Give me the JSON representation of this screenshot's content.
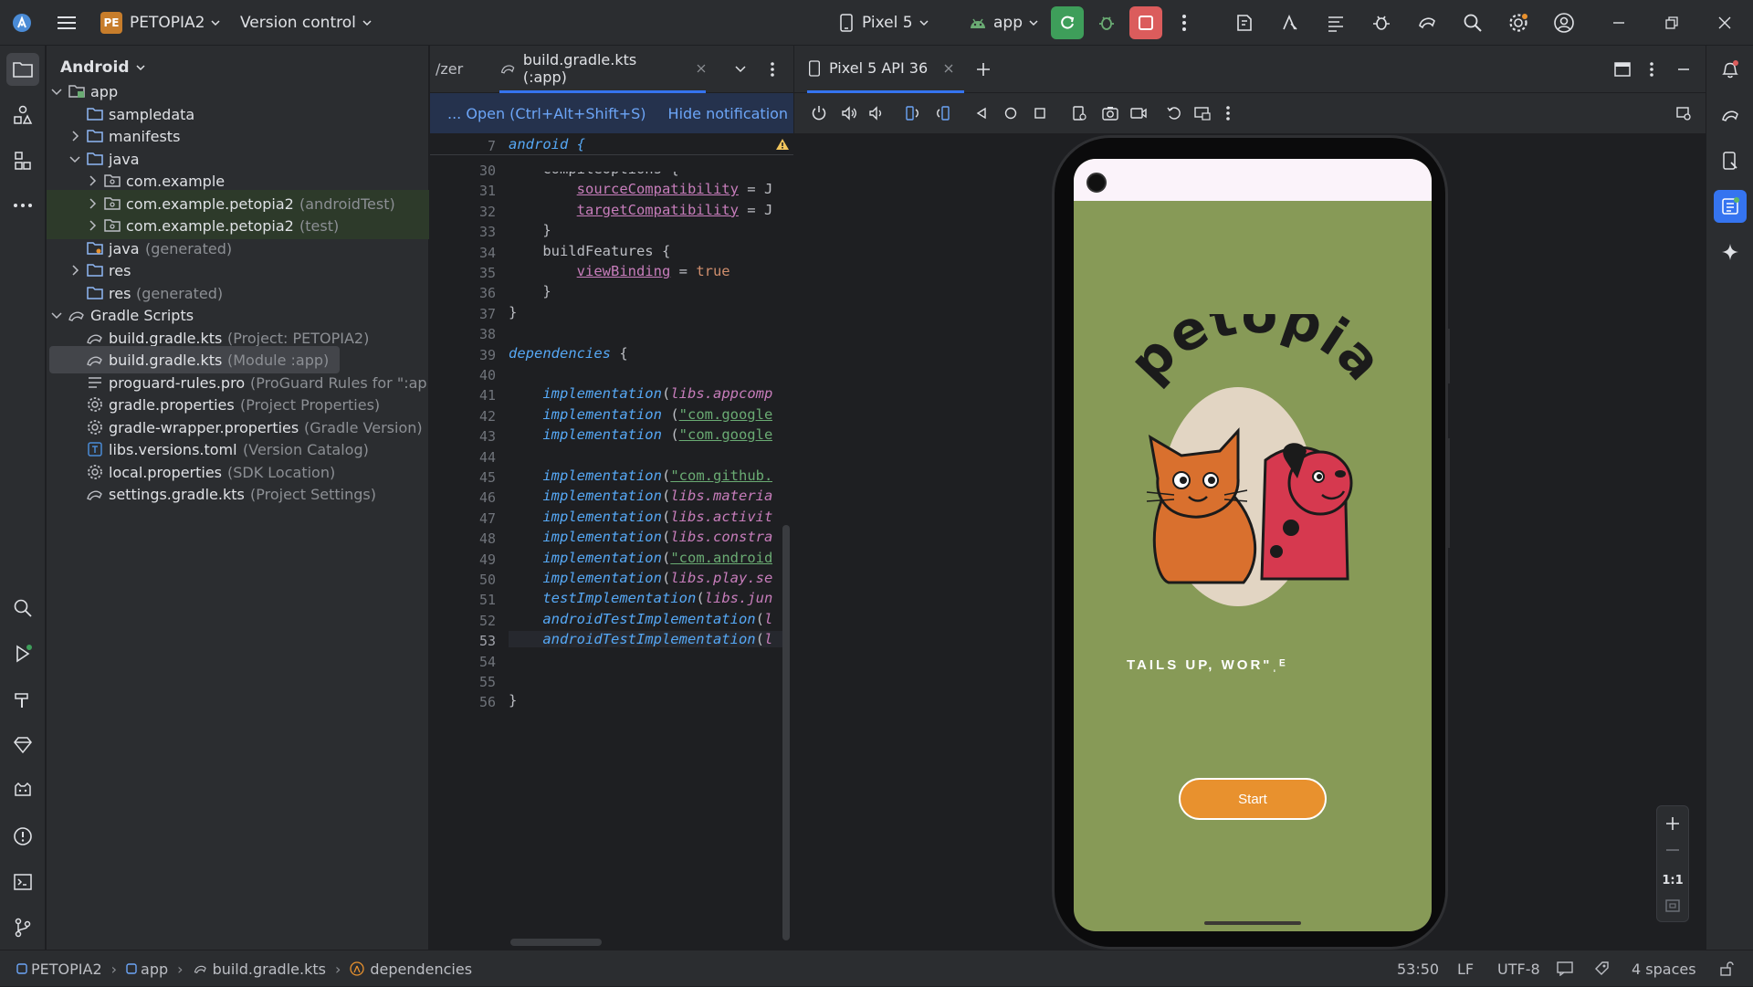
{
  "titlebar": {
    "project_badge": "PE",
    "project_name": "PETOPIA2",
    "vcs_label": "Version control",
    "device_label": "Pixel 5",
    "run_config": "app",
    "accent_green": "#3e9e5a",
    "accent_red": "#db5c5c"
  },
  "project_panel": {
    "title": "Android",
    "tree": [
      {
        "label": "app",
        "hint": "",
        "depth": 0,
        "expanded": true,
        "icon": "module-icon"
      },
      {
        "label": "sampledata",
        "hint": "",
        "depth": 1,
        "expanded": null,
        "icon": "folder-icon"
      },
      {
        "label": "manifests",
        "hint": "",
        "depth": 1,
        "expanded": false,
        "icon": "folder-icon"
      },
      {
        "label": "java",
        "hint": "",
        "depth": 1,
        "expanded": true,
        "icon": "folder-icon"
      },
      {
        "label": "com.example",
        "hint": "",
        "depth": 2,
        "expanded": false,
        "icon": "package-icon"
      },
      {
        "label": "com.example.petopia2",
        "hint": "(androidTest)",
        "depth": 2,
        "expanded": false,
        "icon": "package-icon"
      },
      {
        "label": "com.example.petopia2",
        "hint": "(test)",
        "depth": 2,
        "expanded": false,
        "icon": "package-icon"
      },
      {
        "label": "java",
        "hint": "(generated)",
        "depth": 1,
        "expanded": null,
        "icon": "generated-folder-icon"
      },
      {
        "label": "res",
        "hint": "",
        "depth": 1,
        "expanded": false,
        "icon": "folder-icon"
      },
      {
        "label": "res",
        "hint": "(generated)",
        "depth": 1,
        "expanded": null,
        "icon": "folder-icon"
      },
      {
        "label": "Gradle Scripts",
        "hint": "",
        "depth": 0,
        "expanded": true,
        "icon": "gradle-icon"
      },
      {
        "label": "build.gradle.kts",
        "hint": "(Project: PETOPIA2)",
        "depth": 1,
        "expanded": null,
        "icon": "gradle-icon"
      },
      {
        "label": "build.gradle.kts",
        "hint": "(Module :app)",
        "depth": 1,
        "expanded": null,
        "icon": "gradle-icon"
      },
      {
        "label": "proguard-rules.pro",
        "hint": "(ProGuard Rules for \":ap",
        "depth": 1,
        "expanded": null,
        "icon": "text-file-icon"
      },
      {
        "label": "gradle.properties",
        "hint": "(Project Properties)",
        "depth": 1,
        "expanded": null,
        "icon": "settings-icon"
      },
      {
        "label": "gradle-wrapper.properties",
        "hint": "(Gradle Version)",
        "depth": 1,
        "expanded": null,
        "icon": "settings-icon"
      },
      {
        "label": "libs.versions.toml",
        "hint": "(Version Catalog)",
        "depth": 1,
        "expanded": null,
        "icon": "toml-icon"
      },
      {
        "label": "local.properties",
        "hint": "(SDK Location)",
        "depth": 1,
        "expanded": null,
        "icon": "settings-icon"
      },
      {
        "label": "settings.gradle.kts",
        "hint": "(Project Settings)",
        "depth": 1,
        "expanded": null,
        "icon": "gradle-icon"
      }
    ]
  },
  "editor": {
    "prev_tab": "/zer",
    "active_tab": "build.gradle.kts (:app)",
    "notification_open": "... Open (Ctrl+Alt+Shift+S)",
    "notification_hide": "Hide notification",
    "sticky_line_no": "7",
    "sticky_line": "android {",
    "lines": [
      {
        "n": "30",
        "html": "    <span>compileOptions {</span>"
      },
      {
        "n": "31",
        "html": "        <span class=\"prop\">sourceCompatibility</span> = J"
      },
      {
        "n": "32",
        "html": "        <span class=\"prop\">targetCompatibility</span> = J"
      },
      {
        "n": "33",
        "html": "    }"
      },
      {
        "n": "34",
        "html": "    buildFeatures {"
      },
      {
        "n": "35",
        "html": "        <span class=\"prop\">viewBinding</span> = <span class=\"kw\">true</span>"
      },
      {
        "n": "36",
        "html": "    }"
      },
      {
        "n": "37",
        "html": "}"
      },
      {
        "n": "38",
        "html": ""
      },
      {
        "n": "39",
        "html": "<span class=\"fn\">dependencies</span> {"
      },
      {
        "n": "40",
        "html": ""
      },
      {
        "n": "41",
        "html": "    <span class=\"fn\">implementation</span>(<span class=\"it\" style=\"color:#c77dbb\">libs.appcomp</span>"
      },
      {
        "n": "42",
        "html": "    <span class=\"fn\">implementation</span> (<span class=\"str\">\"com.google</span>"
      },
      {
        "n": "43",
        "html": "    <span class=\"fn\">implementation</span> (<span class=\"str\">\"com.google</span>"
      },
      {
        "n": "44",
        "html": ""
      },
      {
        "n": "45",
        "html": "    <span class=\"fn\">implementation</span>(<span class=\"str\">\"com.github.</span>"
      },
      {
        "n": "46",
        "html": "    <span class=\"fn\">implementation</span>(<span class=\"it\" style=\"color:#c77dbb\">libs.materia</span>"
      },
      {
        "n": "47",
        "html": "    <span class=\"fn\">implementation</span>(<span class=\"it\" style=\"color:#c77dbb\">libs.activit</span>"
      },
      {
        "n": "48",
        "html": "    <span class=\"fn\">implementation</span>(<span class=\"it\" style=\"color:#c77dbb\">libs.constra</span>"
      },
      {
        "n": "49",
        "html": "    <span class=\"fn\">implementation</span>(<span class=\"str\">\"com.android</span>"
      },
      {
        "n": "50",
        "html": "    <span class=\"fn\">implementation</span>(<span class=\"it\" style=\"color:#c77dbb\">libs.play.se</span>"
      },
      {
        "n": "51",
        "html": "    <span class=\"fn\">testImplementation</span>(<span class=\"it\" style=\"color:#c77dbb\">libs.jun</span>"
      },
      {
        "n": "52",
        "html": "    <span class=\"fn\">androidTestImplementation</span>(<span class=\"it\" style=\"color:#c77dbb\">l</span>"
      },
      {
        "n": "53",
        "html": "    <span class=\"fn\">androidTestImplementation</span>(<span class=\"it\" style=\"color:#c77dbb\">l</span>"
      },
      {
        "n": "54",
        "html": ""
      },
      {
        "n": "55",
        "html": ""
      },
      {
        "n": "56",
        "html": "}"
      }
    ]
  },
  "emulator": {
    "tab_label": "Pixel 5 API 36",
    "app": {
      "logo_text": "petopia",
      "tagline": "TAILS UP, WOR\"ˌᴱ",
      "start_label": "Start",
      "bg_color": "#879a57",
      "button_color": "#e8912e"
    },
    "zoom_label": "1:1"
  },
  "statusbar": {
    "breadcrumbs": [
      "PETOPIA2",
      "app",
      "build.gradle.kts",
      "dependencies"
    ],
    "position": "53:50",
    "line_sep": "LF",
    "encoding": "UTF-8",
    "indent": "4 spaces"
  }
}
